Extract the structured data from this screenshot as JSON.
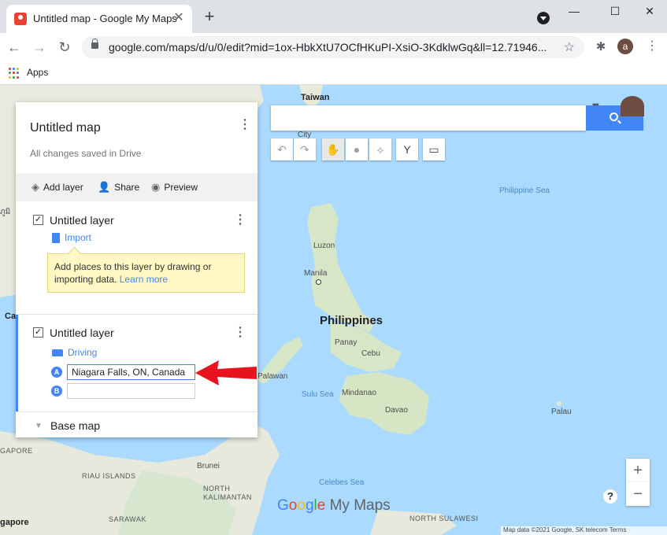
{
  "browser": {
    "tab_title": "Untitled map - Google My Maps",
    "tab_close": "✕",
    "new_tab": "+",
    "window_controls": {
      "minimize": "—",
      "maximize": "☐",
      "close": "✕"
    },
    "url": "google.com/maps/d/u/0/edit?mid=1ox-HbkXtU7OCfHKuPI-XsiO-3KdklwGq&ll=12.71946...",
    "profile_initial": "a",
    "bookmarks": {
      "apps_label": "Apps"
    }
  },
  "search": {
    "placeholder": ""
  },
  "map_labels": {
    "taiwan": "Taiwan",
    "city": "City",
    "philippine_sea": "Philippine Sea",
    "luzon": "Luzon",
    "manila": "Manila",
    "philippines": "Philippines",
    "panay": "Panay",
    "cebu": "Cebu",
    "palawan": "Palawan",
    "sulu_sea": "Sulu Sea",
    "mindanao": "Mindanao",
    "davao": "Davao",
    "palau": "Palau",
    "celebes_sea": "Celebes Sea",
    "brunei": "Brunei",
    "riau_islands": "RIAU ISLANDS",
    "north_kalimantan": "NORTH\nKALIMANTAN",
    "sarawak": "SARAWAK",
    "north_sulawesi": "NORTH SULAWESI",
    "gapore": "gapore",
    "ca": "Ca",
    "thai_edge": "ภูมิ",
    "gapore_region": "GAPORE"
  },
  "panel": {
    "title": "Untitled map",
    "status": "All changes saved in Drive",
    "actions": {
      "add_layer": "Add layer",
      "share": "Share",
      "preview": "Preview"
    },
    "layer1": {
      "name": "Untitled layer",
      "import_label": "Import",
      "tooltip_text": "Add places to this layer by drawing or importing data.",
      "tooltip_link": "Learn more"
    },
    "layer2": {
      "name": "Untitled layer",
      "mode_label": "Driving",
      "point_a_label": "A",
      "point_a_value": "Niagara Falls, ON, Canada",
      "point_b_label": "B",
      "point_b_value": ""
    },
    "base_map_label": "Base map"
  },
  "zoom": {
    "in": "+",
    "out": "−"
  },
  "help": "?",
  "logo": {
    "g": "G",
    "o1": "o",
    "o2": "o",
    "g2": "g",
    "l": "l",
    "e": "e",
    "rest": " My Maps"
  },
  "attribution": "Map data ©2021 Google, SK telecom   Terms",
  "colors": {
    "accent": "#4285f4",
    "annotation_arrow": "#e8131f",
    "water": "#aadaff"
  }
}
